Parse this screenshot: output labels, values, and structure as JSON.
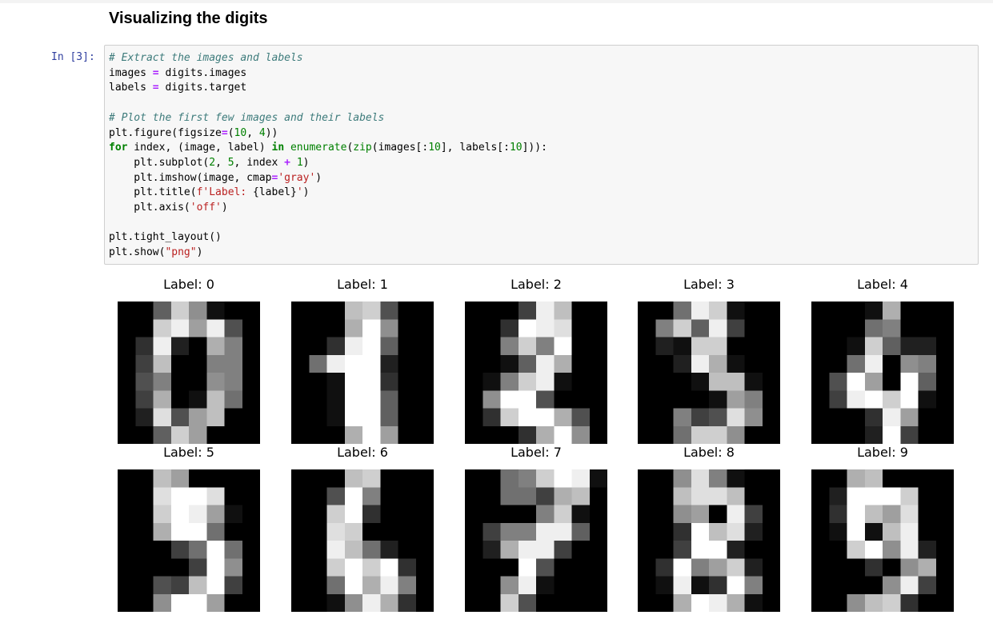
{
  "heading": "Visualizing the digits",
  "cell": {
    "prompt": "In [3]:",
    "code_lines": [
      [
        {
          "t": "cm",
          "v": "# Extract the images and labels"
        }
      ],
      [
        {
          "t": "",
          "v": "images "
        },
        {
          "t": "op",
          "v": "="
        },
        {
          "t": "",
          "v": " digits.images"
        }
      ],
      [
        {
          "t": "",
          "v": "labels "
        },
        {
          "t": "op",
          "v": "="
        },
        {
          "t": "",
          "v": " digits.target"
        }
      ],
      [],
      [
        {
          "t": "cm",
          "v": "# Plot the first few images and their labels"
        }
      ],
      [
        {
          "t": "",
          "v": "plt.figure(figsize"
        },
        {
          "t": "op",
          "v": "="
        },
        {
          "t": "",
          "v": "("
        },
        {
          "t": "num",
          "v": "10"
        },
        {
          "t": "",
          "v": ", "
        },
        {
          "t": "num",
          "v": "4"
        },
        {
          "t": "",
          "v": "))"
        }
      ],
      [
        {
          "t": "kw",
          "v": "for"
        },
        {
          "t": "",
          "v": " index, (image, label) "
        },
        {
          "t": "kw",
          "v": "in"
        },
        {
          "t": "",
          "v": " "
        },
        {
          "t": "nb",
          "v": "enumerate"
        },
        {
          "t": "",
          "v": "("
        },
        {
          "t": "nb",
          "v": "zip"
        },
        {
          "t": "",
          "v": "(images[:"
        },
        {
          "t": "num",
          "v": "10"
        },
        {
          "t": "",
          "v": "], labels[:"
        },
        {
          "t": "num",
          "v": "10"
        },
        {
          "t": "",
          "v": "])):"
        }
      ],
      [
        {
          "t": "",
          "v": "    plt.subplot("
        },
        {
          "t": "num",
          "v": "2"
        },
        {
          "t": "",
          "v": ", "
        },
        {
          "t": "num",
          "v": "5"
        },
        {
          "t": "",
          "v": ", index "
        },
        {
          "t": "op",
          "v": "+"
        },
        {
          "t": "",
          "v": " "
        },
        {
          "t": "num",
          "v": "1"
        },
        {
          "t": "",
          "v": ")"
        }
      ],
      [
        {
          "t": "",
          "v": "    plt.imshow(image, cmap"
        },
        {
          "t": "op",
          "v": "="
        },
        {
          "t": "str",
          "v": "'gray'"
        },
        {
          "t": "",
          "v": ")"
        }
      ],
      [
        {
          "t": "",
          "v": "    plt.title("
        },
        {
          "t": "str",
          "v": "f'Label: "
        },
        {
          "t": "",
          "v": "{label}"
        },
        {
          "t": "str",
          "v": "'"
        },
        {
          "t": "",
          "v": ")"
        }
      ],
      [
        {
          "t": "",
          "v": "    plt.axis("
        },
        {
          "t": "str",
          "v": "'off'"
        },
        {
          "t": "",
          "v": ")"
        }
      ],
      [],
      [
        {
          "t": "",
          "v": "plt.tight_layout()"
        }
      ],
      [
        {
          "t": "",
          "v": "plt.show("
        },
        {
          "t": "str",
          "v": "\"png\""
        },
        {
          "t": "",
          "v": ")"
        }
      ]
    ]
  },
  "digits": [
    {
      "title": "Label: 0",
      "pixels": [
        [
          0,
          0,
          6,
          13,
          9,
          1,
          0,
          0
        ],
        [
          0,
          0,
          13,
          15,
          10,
          15,
          5,
          0
        ],
        [
          0,
          3,
          15,
          2,
          0,
          11,
          8,
          0
        ],
        [
          0,
          4,
          12,
          0,
          0,
          8,
          8,
          0
        ],
        [
          0,
          5,
          8,
          0,
          0,
          9,
          8,
          0
        ],
        [
          0,
          4,
          11,
          0,
          1,
          12,
          7,
          0
        ],
        [
          0,
          2,
          14,
          5,
          10,
          12,
          0,
          0
        ],
        [
          0,
          0,
          6,
          13,
          10,
          0,
          0,
          0
        ]
      ]
    },
    {
      "title": "Label: 1",
      "pixels": [
        [
          0,
          0,
          0,
          12,
          13,
          5,
          0,
          0
        ],
        [
          0,
          0,
          0,
          11,
          16,
          9,
          0,
          0
        ],
        [
          0,
          0,
          3,
          15,
          16,
          6,
          0,
          0
        ],
        [
          0,
          7,
          15,
          16,
          16,
          2,
          0,
          0
        ],
        [
          0,
          0,
          1,
          16,
          16,
          3,
          0,
          0
        ],
        [
          0,
          0,
          1,
          16,
          16,
          6,
          0,
          0
        ],
        [
          0,
          0,
          1,
          16,
          16,
          6,
          0,
          0
        ],
        [
          0,
          0,
          0,
          11,
          16,
          10,
          0,
          0
        ]
      ]
    },
    {
      "title": "Label: 2",
      "pixels": [
        [
          0,
          0,
          0,
          4,
          15,
          12,
          0,
          0
        ],
        [
          0,
          0,
          3,
          16,
          15,
          14,
          0,
          0
        ],
        [
          0,
          0,
          8,
          13,
          8,
          16,
          0,
          0
        ],
        [
          0,
          0,
          1,
          6,
          15,
          11,
          0,
          0
        ],
        [
          0,
          1,
          8,
          13,
          15,
          1,
          0,
          0
        ],
        [
          0,
          9,
          16,
          16,
          5,
          0,
          0,
          0
        ],
        [
          0,
          3,
          13,
          16,
          16,
          11,
          5,
          0
        ],
        [
          0,
          0,
          0,
          3,
          11,
          16,
          9,
          0
        ]
      ]
    },
    {
      "title": "Label: 3",
      "pixels": [
        [
          0,
          0,
          7,
          15,
          13,
          1,
          0,
          0
        ],
        [
          0,
          8,
          13,
          6,
          15,
          4,
          0,
          0
        ],
        [
          0,
          2,
          1,
          13,
          13,
          0,
          0,
          0
        ],
        [
          0,
          0,
          2,
          15,
          11,
          1,
          0,
          0
        ],
        [
          0,
          0,
          0,
          1,
          12,
          12,
          1,
          0
        ],
        [
          0,
          0,
          0,
          0,
          1,
          10,
          8,
          0
        ],
        [
          0,
          0,
          8,
          4,
          5,
          14,
          9,
          0
        ],
        [
          0,
          0,
          7,
          13,
          13,
          9,
          0,
          0
        ]
      ]
    },
    {
      "title": "Label: 4",
      "pixels": [
        [
          0,
          0,
          0,
          1,
          11,
          0,
          0,
          0
        ],
        [
          0,
          0,
          0,
          7,
          8,
          0,
          0,
          0
        ],
        [
          0,
          0,
          1,
          13,
          6,
          2,
          2,
          0
        ],
        [
          0,
          0,
          7,
          15,
          0,
          9,
          8,
          0
        ],
        [
          0,
          5,
          16,
          10,
          0,
          16,
          6,
          0
        ],
        [
          0,
          4,
          15,
          16,
          13,
          16,
          1,
          0
        ],
        [
          0,
          0,
          0,
          3,
          15,
          10,
          0,
          0
        ],
        [
          0,
          0,
          0,
          2,
          16,
          4,
          0,
          0
        ]
      ]
    },
    {
      "title": "Label: 5",
      "pixels": [
        [
          0,
          0,
          12,
          10,
          0,
          0,
          0,
          0
        ],
        [
          0,
          0,
          14,
          16,
          16,
          14,
          0,
          0
        ],
        [
          0,
          0,
          13,
          16,
          15,
          10,
          1,
          0
        ],
        [
          0,
          0,
          11,
          16,
          16,
          7,
          0,
          0
        ],
        [
          0,
          0,
          0,
          4,
          7,
          16,
          7,
          0
        ],
        [
          0,
          0,
          0,
          0,
          4,
          16,
          9,
          0
        ],
        [
          0,
          0,
          5,
          4,
          12,
          16,
          4,
          0
        ],
        [
          0,
          0,
          9,
          16,
          16,
          10,
          0,
          0
        ]
      ]
    },
    {
      "title": "Label: 6",
      "pixels": [
        [
          0,
          0,
          0,
          12,
          13,
          0,
          0,
          0
        ],
        [
          0,
          0,
          5,
          16,
          8,
          0,
          0,
          0
        ],
        [
          0,
          0,
          13,
          16,
          3,
          0,
          0,
          0
        ],
        [
          0,
          0,
          14,
          13,
          0,
          0,
          0,
          0
        ],
        [
          0,
          0,
          15,
          12,
          7,
          2,
          0,
          0
        ],
        [
          0,
          0,
          13,
          16,
          13,
          16,
          3,
          0
        ],
        [
          0,
          0,
          7,
          16,
          11,
          15,
          8,
          0
        ],
        [
          0,
          0,
          1,
          9,
          15,
          11,
          3,
          0
        ]
      ]
    },
    {
      "title": "Label: 7",
      "pixels": [
        [
          0,
          0,
          7,
          8,
          13,
          16,
          15,
          1
        ],
        [
          0,
          0,
          7,
          7,
          4,
          11,
          12,
          0
        ],
        [
          0,
          0,
          0,
          0,
          8,
          13,
          1,
          0
        ],
        [
          0,
          4,
          8,
          8,
          15,
          15,
          6,
          0
        ],
        [
          0,
          2,
          11,
          15,
          15,
          4,
          0,
          0
        ],
        [
          0,
          0,
          0,
          16,
          5,
          0,
          0,
          0
        ],
        [
          0,
          0,
          9,
          15,
          1,
          0,
          0,
          0
        ],
        [
          0,
          0,
          13,
          5,
          0,
          0,
          0,
          0
        ]
      ]
    },
    {
      "title": "Label: 8",
      "pixels": [
        [
          0,
          0,
          9,
          14,
          8,
          1,
          0,
          0
        ],
        [
          0,
          0,
          12,
          14,
          14,
          12,
          0,
          0
        ],
        [
          0,
          0,
          9,
          10,
          0,
          15,
          4,
          0
        ],
        [
          0,
          0,
          3,
          16,
          12,
          14,
          2,
          0
        ],
        [
          0,
          0,
          4,
          16,
          16,
          2,
          0,
          0
        ],
        [
          0,
          3,
          16,
          8,
          10,
          13,
          2,
          0
        ],
        [
          0,
          1,
          15,
          1,
          3,
          16,
          8,
          0
        ],
        [
          0,
          0,
          11,
          16,
          15,
          11,
          1,
          0
        ]
      ]
    },
    {
      "title": "Label: 9",
      "pixels": [
        [
          0,
          0,
          11,
          12,
          0,
          0,
          0,
          0
        ],
        [
          0,
          2,
          16,
          16,
          16,
          13,
          0,
          0
        ],
        [
          0,
          3,
          16,
          12,
          10,
          14,
          0,
          0
        ],
        [
          0,
          1,
          16,
          1,
          12,
          15,
          0,
          0
        ],
        [
          0,
          0,
          13,
          16,
          9,
          15,
          2,
          0
        ],
        [
          0,
          0,
          0,
          3,
          0,
          9,
          11,
          0
        ],
        [
          0,
          0,
          0,
          0,
          9,
          15,
          4,
          0
        ],
        [
          0,
          0,
          9,
          12,
          13,
          3,
          0,
          0
        ]
      ]
    }
  ]
}
